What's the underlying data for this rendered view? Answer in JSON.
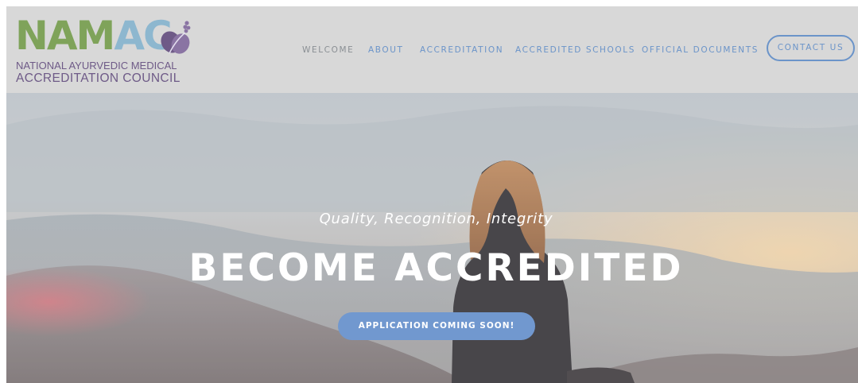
{
  "header": {
    "logo": {
      "part1": "NAM",
      "part2": "AC",
      "line1": "NATIONAL AYURVEDIC MEDICAL",
      "line2": "ACCREDITATION COUNCIL"
    },
    "nav": [
      {
        "label": "WELCOME",
        "active": true
      },
      {
        "label": "ABOUT",
        "active": false
      },
      {
        "label": "ACCREDITATION",
        "active": false
      },
      {
        "label": "ACCREDITED SCHOOLS",
        "active": false
      },
      {
        "label": "OFFICIAL DOCUMENTS",
        "active": false
      }
    ],
    "contact_label": "CONTACT US"
  },
  "hero": {
    "tagline": "Quality, Recognition, Integrity",
    "headline": "BECOME ACCREDITED",
    "cta_label": "APPLICATION COMING SOON!"
  },
  "colors": {
    "header_bg": "#d8d8d8",
    "nav_link": "#6b94c9",
    "nav_active": "#8a8f94",
    "logo_green": "#7fa35a",
    "logo_blue": "#8db7cf",
    "logo_purple": "#6e5a87",
    "cta_bg": "#7198cf"
  }
}
